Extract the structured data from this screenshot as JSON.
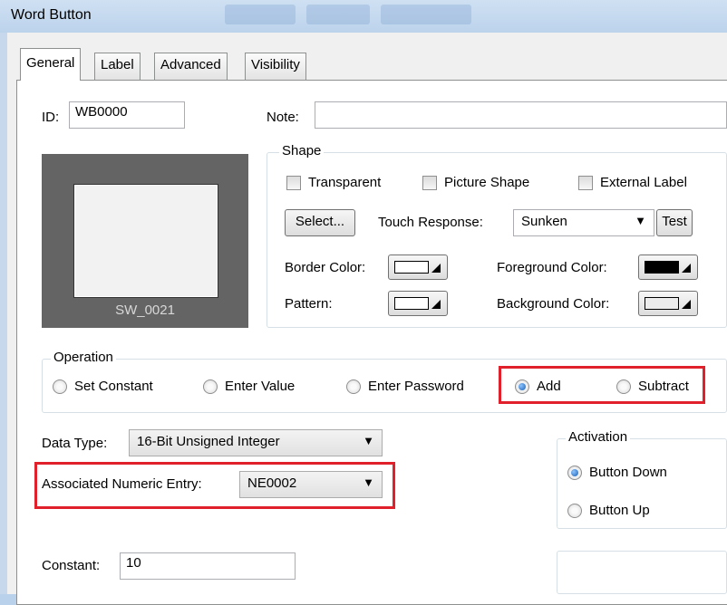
{
  "window": {
    "title": "Word Button"
  },
  "tabs": [
    {
      "label": "General",
      "active": true
    },
    {
      "label": "Label",
      "active": false
    },
    {
      "label": "Advanced",
      "active": false
    },
    {
      "label": "Visibility",
      "active": false
    }
  ],
  "general": {
    "id_label": "ID:",
    "id_value": "WB0000",
    "note_label": "Note:",
    "note_value": "",
    "preview_label": "SW_0021"
  },
  "shape": {
    "group_label": "Shape",
    "transparent": {
      "label": "Transparent",
      "checked": false
    },
    "picture_shape": {
      "label": "Picture Shape",
      "checked": false
    },
    "external_label": {
      "label": "External Label",
      "checked": false
    },
    "select_button": "Select...",
    "touch_response_label": "Touch Response:",
    "touch_response_value": "Sunken",
    "test_button": "Test",
    "border_color_label": "Border Color:",
    "foreground_color_label": "Foreground Color:",
    "pattern_label": "Pattern:",
    "background_color_label": "Background Color:"
  },
  "operation": {
    "group_label": "Operation",
    "options": [
      {
        "label": "Set Constant",
        "checked": false
      },
      {
        "label": "Enter Value",
        "checked": false
      },
      {
        "label": "Enter Password",
        "checked": false
      },
      {
        "label": "Add",
        "checked": true
      },
      {
        "label": "Subtract",
        "checked": false
      }
    ]
  },
  "data_type": {
    "label": "Data Type:",
    "value": "16-Bit Unsigned Integer"
  },
  "associated_numeric_entry": {
    "label": "Associated Numeric Entry:",
    "value": "NE0002"
  },
  "activation": {
    "group_label": "Activation",
    "options": [
      {
        "label": "Button Down",
        "checked": true
      },
      {
        "label": "Button Up",
        "checked": false
      }
    ]
  },
  "constant": {
    "label": "Constant:",
    "value": "10"
  },
  "colors": {
    "highlight": "#e0202a",
    "preview_bg": "#646464",
    "titlebar": "#c7dbf0"
  },
  "icons": {
    "dropdown": "chevron-down-icon",
    "color_dropdown": "triangle-icon"
  }
}
